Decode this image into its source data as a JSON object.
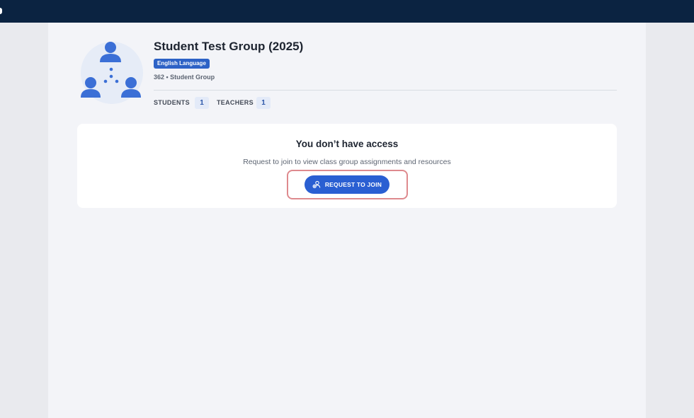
{
  "group": {
    "title": "Student Test Group (2025)",
    "subject": "English Language",
    "meta": "362 • Student Group",
    "icon": "group-people-icon"
  },
  "stats": {
    "students_label": "STUDENTS",
    "students_count": "1",
    "teachers_label": "TEACHERS",
    "teachers_count": "1"
  },
  "access": {
    "title": "You don’t have access",
    "description": "Request to join to view class group assignments and resources",
    "button_label": "REQUEST TO JOIN",
    "button_icon": "person-add-icon"
  },
  "colors": {
    "topbar": "#0b2341",
    "accent": "#2a5fd2",
    "highlight": "#de8a8e"
  }
}
